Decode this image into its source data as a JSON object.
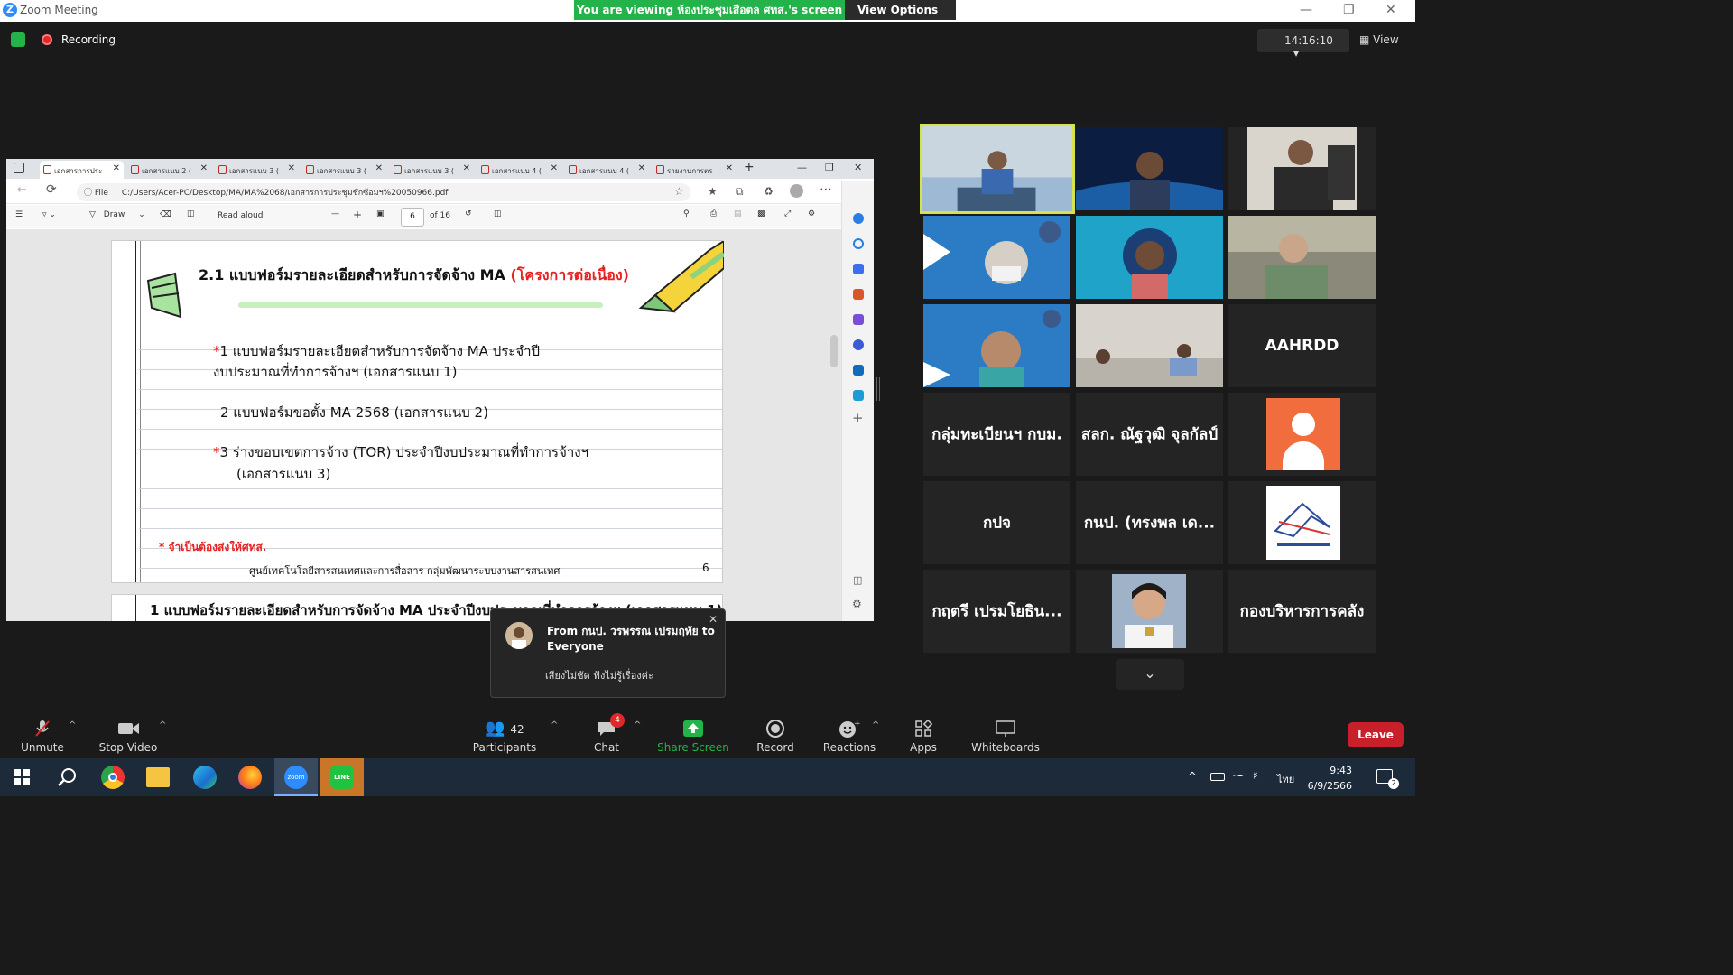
{
  "window": {
    "title": "Zoom Meeting",
    "banner": "You are viewing ห้องประชุมเสือตล ศทส.'s screen",
    "view_options": "View Options"
  },
  "topbar": {
    "recording": "Recording",
    "timer": "14:16:10",
    "view": "View"
  },
  "browser": {
    "tabs": [
      {
        "label": "เอกสารการประ"
      },
      {
        "label": "เอกสารแนบ 2 ("
      },
      {
        "label": "เอกสารแนบ 3 ("
      },
      {
        "label": "เอกสารแนบ 3 ("
      },
      {
        "label": "เอกสารแนบ 3 ("
      },
      {
        "label": "เอกสารแนบ 4 ("
      },
      {
        "label": "เอกสารแนบ 4 ("
      },
      {
        "label": "รายงานการตร"
      }
    ],
    "file_label": "File",
    "url": "C:/Users/Acer-PC/Desktop/MA/MA%2068/เอกสารการประชุมชักซ้อมฯ%20050966.pdf",
    "pdf_toolbar": {
      "draw": "Draw",
      "read_aloud": "Read aloud",
      "page": "6",
      "of_pages": "of 16"
    },
    "doc": {
      "heading": "2.1 แบบฟอร์มรายละเอียดสำหรับการจัดจ้าง MA",
      "heading_red": "(โครงการต่อเนื่อง)",
      "item1_line1": "1 แบบฟอร์มรายละเอียดสำหรับการจัดจ้าง MA ประจำปี",
      "item1_line2": "งบประมาณที่ทำการจ้างฯ (เอกสารแนบ 1)",
      "item2": "2 แบบฟอร์มขอตั้ง MA 2568 (เอกสารแนบ 2)",
      "item3_line1": "3 ร่างขอบเขตการจ้าง (TOR) ประจำปีงบประมาณที่ทำการจ้างฯ",
      "item3_line2": "(เอกสารแนบ 3)",
      "asterisk": "*",
      "note": "* จำเป็นต้องส่งให้ศทส.",
      "footer": "ศูนย์เทคโนโลยีสารสนเทศและการสื่อสาร กลุ่มพัฒนาระบบงานสารสนเทศ",
      "page_no": "6",
      "next_page_heading": "1 แบบฟอร์มรายละเอียดสำหรับการจัดจ้าง MA ประจำปีงบประมาณที่ทำการจ้างฯ (เอกสารแนบ 1)"
    }
  },
  "gallery": {
    "names": {
      "aahrdd": "AAHRDD",
      "t1": "กลุ่มทะเบียนฯ กบม.",
      "t2": "สลก. ณัฐวุฒิ จุลกัลป์",
      "t3": "กปจ",
      "t4": "กนป. (ทรงพล เด...",
      "t5": "กฤตรี เปรมโยธิน...",
      "t6": "กองบริหารการคลัง"
    }
  },
  "chat_popup": {
    "from": "From กนป. วรพรรณ เปรมฤทัย to Everyone",
    "message": "เสียงไม่ชัด ฟังไม่รู้เรื่องค่ะ"
  },
  "toolbar": {
    "unmute": "Unmute",
    "stop_video": "Stop Video",
    "participants": "Participants",
    "participants_count": "42",
    "chat": "Chat",
    "chat_badge": "4",
    "share_screen": "Share Screen",
    "record": "Record",
    "reactions": "Reactions",
    "apps": "Apps",
    "whiteboards": "Whiteboards",
    "leave": "Leave"
  },
  "taskbar": {
    "lang": "ไทย",
    "time": "9:43",
    "date": "6/9/2566",
    "notif_count": "2"
  },
  "colors": {
    "zoom_green": "#23b34a",
    "leave_red": "#c8202b",
    "active_speaker": "#d5e34c",
    "doc_red": "#e8201f"
  }
}
